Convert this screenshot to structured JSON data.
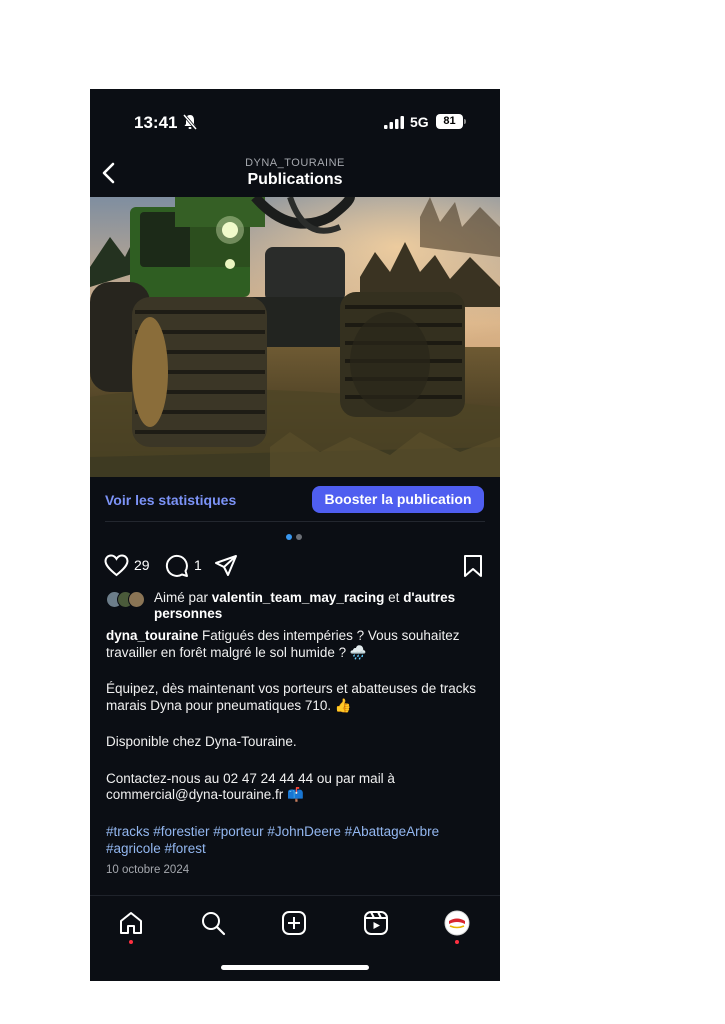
{
  "status_bar": {
    "time": "13:41",
    "network": "5G",
    "battery": "81"
  },
  "header": {
    "account": "DYNA_TOURAINE",
    "title": "Publications"
  },
  "post": {
    "stats_link": "Voir les statistiques",
    "boost_button": "Booster la publication",
    "likes_count": "29",
    "comments_count": "1",
    "liked_by": {
      "prefix": "Aimé par",
      "user": "valentin_team_may_racing",
      "connector": "et",
      "others": "d'autres personnes"
    },
    "caption": {
      "username": "dyna_touraine",
      "line1": "Fatigués des intempéries ? Vous souhaitez travailler en forêt malgré le sol humide ? 🌧️",
      "line2": "Équipez, dès maintenant vos porteurs et abatteuses de tracks marais Dyna pour pneumatiques 710. 👍",
      "line3": "Disponible chez Dyna-Touraine.",
      "line4": "Contactez-nous au 02 47 24 44 44 ou par mail à commercial@dyna-touraine.fr 📫"
    },
    "hashtags": "#tracks #forestier #porteur #JohnDeere #AbattageArbre #agricole #forest",
    "date": "10 octobre 2024"
  },
  "colors": {
    "background": "#0b0e14",
    "link": "#7c93f7",
    "boost": "#4f5ef0",
    "hashtag": "#93b7f0",
    "notification": "#ff3040"
  },
  "icons": [
    "bell-muted-icon",
    "signal-icon",
    "back-chevron-icon",
    "heart-icon",
    "comment-icon",
    "share-icon",
    "bookmark-icon",
    "home-icon",
    "search-icon",
    "create-icon",
    "reels-icon",
    "profile-avatar-icon"
  ]
}
